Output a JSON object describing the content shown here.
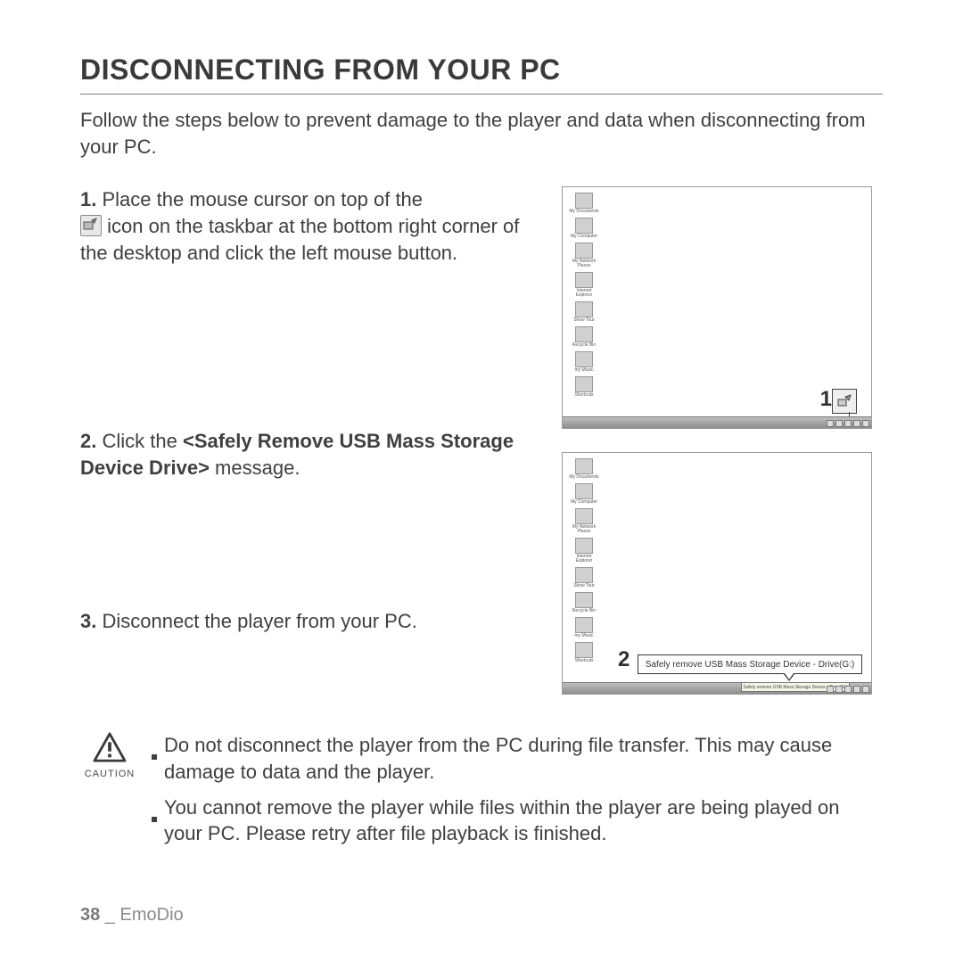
{
  "title": "DISCONNECTING FROM YOUR PC",
  "intro": "Follow the steps below to prevent damage to the player and data when disconnecting from your PC.",
  "steps": {
    "s1_num": "1.",
    "s1_a": "Place the mouse cursor on top of the",
    "s1_b": "icon on the taskbar at the bottom right corner of the desktop and click the left mouse button.",
    "s2_num": "2.",
    "s2_a": "Click the ",
    "s2_bold": "<Safely Remove USB Mass Storage Device Drive>",
    "s2_b": " message.",
    "s3_num": "3.",
    "s3_a": "Disconnect the player from your PC."
  },
  "callouts": {
    "one": "1",
    "two": "2",
    "bubble": "Safely remove USB Mass Storage Device - Drive(G:)",
    "mini": "Safely remove USB Mass Storage Device - Drive(G:)"
  },
  "desktop_icons": [
    "My Documents",
    "My Computer",
    "My Network Places",
    "Internet Explorer",
    "Show Tour",
    "Recycle Bin",
    "my Music",
    "Shortcuts"
  ],
  "caution_label": "CAUTION",
  "cautions": [
    "Do not disconnect the player from the PC during file transfer. This may cause damage to data and the player.",
    "You cannot remove the player while files within the player are being played on your PC. Please retry after file playback is finished."
  ],
  "footer": {
    "page": "38",
    "sep": " _ ",
    "section": "EmoDio"
  }
}
